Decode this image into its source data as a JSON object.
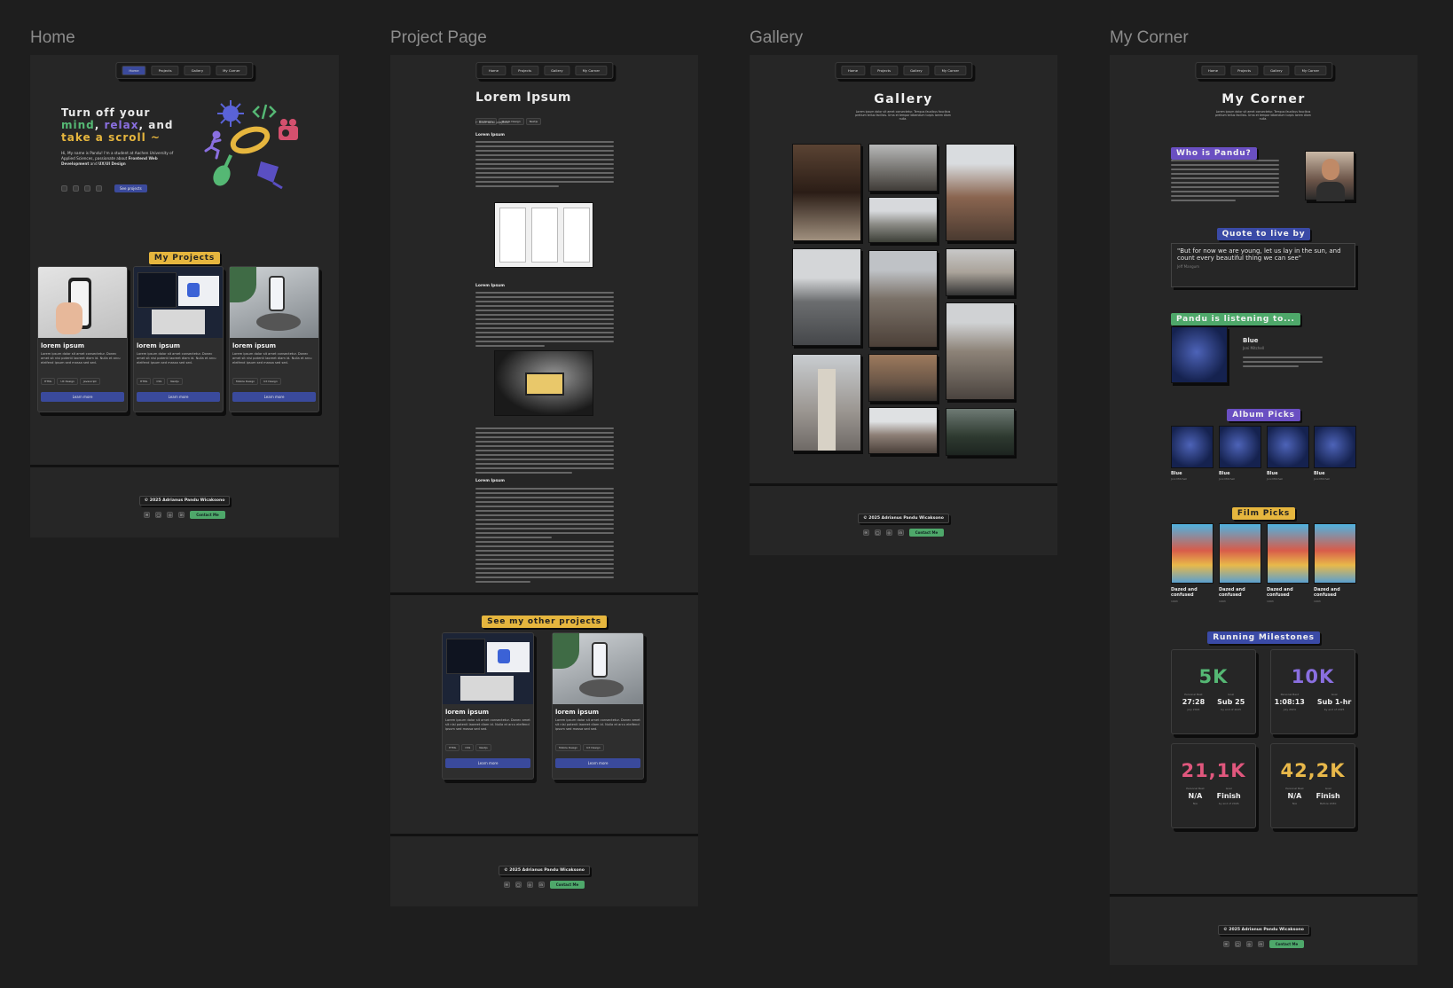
{
  "frames": {
    "home": "Home",
    "project": "Project Page",
    "gallery": "Gallery",
    "corner": "My Corner"
  },
  "nav": [
    "Home",
    "Projects",
    "Gallery",
    "My Corner"
  ],
  "home": {
    "hero_line1": "Turn off your",
    "hero_mind": "mind",
    "hero_comma1": ",",
    "hero_relax": "relax",
    "hero_and": ", and",
    "hero_scroll": "take a scroll ~",
    "intro_a": "Hi, My name is Pandu! I'm a student at Aachen University of Applied Sciences, passionate about ",
    "intro_b": "Frontend Web Development",
    "intro_c": " and ",
    "intro_d": "UX/UI Design",
    "see_projects": "See projects",
    "my_projects": "My Projects",
    "cards": [
      {
        "title": "lorem ipsum",
        "body": "Lorem ipsum dolor sit amet consectetur. Donec amet sit nisi potenti laoreet diam id. Nulla et arcu eleifend ipsum sed massa sed sed.",
        "tags": [
          "HTML",
          "UX Design",
          "Javascript"
        ],
        "button": "Learn more"
      },
      {
        "title": "lorem ipsum",
        "body": "Lorem ipsum dolor sit amet consectetur. Donec amet sit nisi potenti laoreet diam id. Nulla et arcu eleifend ipsum sed massa sed sed.",
        "tags": [
          "HTML",
          "CSS",
          "Nextjs"
        ],
        "button": "Learn more"
      },
      {
        "title": "lorem ipsum",
        "body": "Lorem ipsum dolor sit amet consectetur. Donec amet sit nisi potenti laoreet diam id. Nulla et arcu eleifend ipsum sed massa sed sed.",
        "tags": [
          "Mobile Design",
          "UX Design"
        ],
        "button": "Learn more"
      }
    ]
  },
  "project": {
    "title": "Lorem Ipsum",
    "tags": [
      "UX Design",
      "Mobile Design",
      "Nextjs"
    ],
    "back": "←  Back to all projects",
    "section": "Lorem Ipsum",
    "other": "See my other projects",
    "cards": [
      {
        "title": "lorem ipsum",
        "body": "Lorem ipsum dolor sit amet consectetur. Donec amet sit nisi potenti laoreet diam id. Nulla et arcu eleifend ipsum sed massa sed sed.",
        "tags": [
          "HTML",
          "CSS",
          "Nextjs"
        ],
        "button": "Learn more"
      },
      {
        "title": "lorem ipsum",
        "body": "Lorem ipsum dolor sit amet consectetur. Donec amet sit nisi potenti laoreet diam id. Nulla et arcu eleifend ipsum sed massa sed sed.",
        "tags": [
          "Mobile Design",
          "UX Design"
        ],
        "button": "Learn more"
      }
    ]
  },
  "gallery": {
    "title": "Gallery",
    "subtitle": "Lorem ipsum dolor sit amet consectetur. Tempus faucibus faucibus pretium tellus facilisis. Urna et tempor bibendum turpis lorem diam nulla."
  },
  "corner": {
    "title": "My Corner",
    "subtitle": "Lorem ipsum dolor sit amet consectetur. Tempus faucibus faucibus pretium tellus facilisis. Urna et tempor bibendum turpis lorem diam nulla.",
    "who": "Who is Pandu?",
    "quote_label": "Quote to live by",
    "quote": "\"But for now we are young, let us lay in the sun, and count every beautiful thing we can see\"",
    "quote_author": "Jeff Mangum",
    "listening": "Pandu is listening to...",
    "song": "Blue",
    "artist": "Joni Mitchell",
    "album_picks": "Album Picks",
    "albums": [
      {
        "title": "Blue",
        "artist": "Joni Mitchell"
      },
      {
        "title": "Blue",
        "artist": "Joni Mitchell"
      },
      {
        "title": "Blue",
        "artist": "Joni Mitchell"
      },
      {
        "title": "Blue",
        "artist": "Joni Mitchell"
      }
    ],
    "film_picks": "Film Picks",
    "films": [
      {
        "title": "Dazed and confused",
        "year": "1993"
      },
      {
        "title": "Dazed and confused",
        "year": "1993"
      },
      {
        "title": "Dazed and confused",
        "year": "1993"
      },
      {
        "title": "Dazed and confused",
        "year": "1993"
      }
    ],
    "running": "Running Milestones",
    "runs": [
      {
        "distance": "5K",
        "color": "#55b874",
        "pb_label": "Personal Best",
        "pb": "27:28",
        "pb_date": "July 2024",
        "goal_label": "Goal",
        "goal": "Sub 25",
        "goal_date": "by end of 2025"
      },
      {
        "distance": "10K",
        "color": "#8a6fe0",
        "pb_label": "Personal Best",
        "pb": "1:08:13",
        "pb_date": "July 2024",
        "goal_label": "Goal",
        "goal": "Sub 1-hr",
        "goal_date": "by end of 2025"
      },
      {
        "distance": "21,1K",
        "color": "#e0577d",
        "pb_label": "Personal Best",
        "pb": "N/A",
        "pb_date": "N/A",
        "goal_label": "Goal",
        "goal": "Finish",
        "goal_date": "by end of 2026"
      },
      {
        "distance": "42,2K",
        "color": "#e8b84a",
        "pb_label": "Personal Best",
        "pb": "N/A",
        "pb_date": "N/A",
        "goal_label": "Goal",
        "goal": "Finish",
        "goal_date": "Before 2030"
      }
    ]
  },
  "footer": {
    "copyright": "© 2025 Adrianus Pandu Wicaksono",
    "contact": "Contact Me",
    "socials": [
      "✉",
      "◯",
      "◎",
      "in"
    ]
  },
  "colors": {
    "bg": "#1e1e1e",
    "frame": "#262626",
    "accent_blue": "#3b4a9c",
    "accent_yellow": "#e6b63e",
    "accent_purple": "#6a4fc2",
    "accent_green": "#4ea86a"
  }
}
